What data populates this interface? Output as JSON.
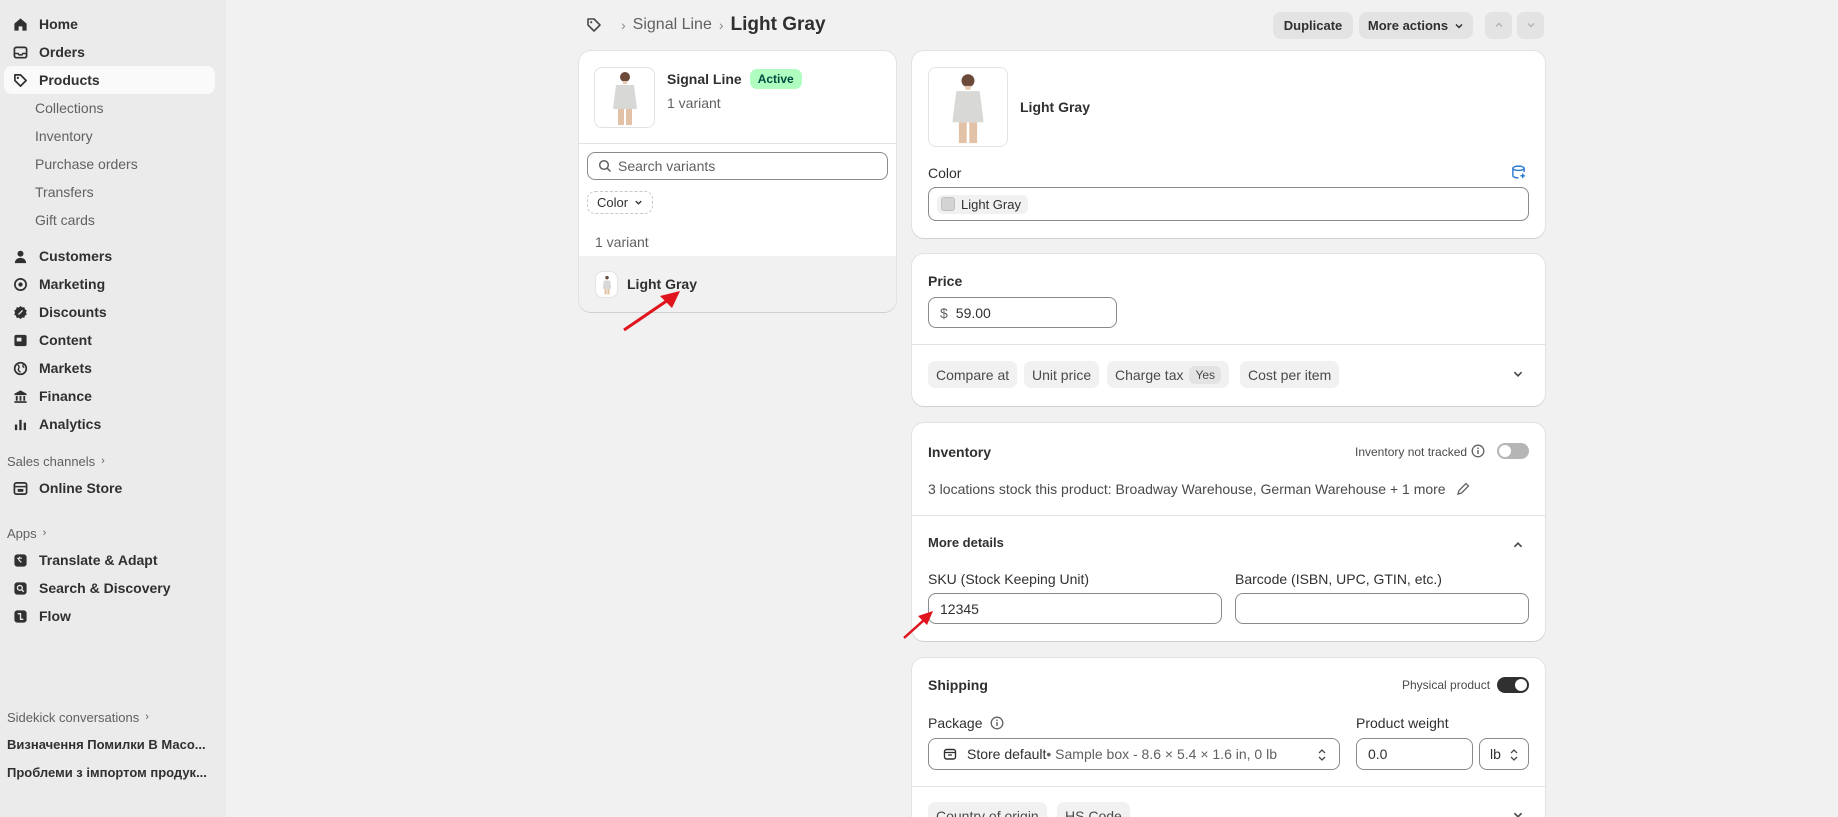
{
  "sidebar": {
    "nav": [
      {
        "label": "Home",
        "icon": "home-icon"
      },
      {
        "label": "Orders",
        "icon": "inbox-icon"
      },
      {
        "label": "Products",
        "icon": "tag-icon"
      }
    ],
    "product_sub": [
      "Collections",
      "Inventory",
      "Purchase orders",
      "Transfers",
      "Gift cards"
    ],
    "nav2": [
      {
        "label": "Customers",
        "icon": "person-icon"
      },
      {
        "label": "Marketing",
        "icon": "target-icon"
      },
      {
        "label": "Discounts",
        "icon": "discount-icon"
      },
      {
        "label": "Content",
        "icon": "content-icon"
      },
      {
        "label": "Markets",
        "icon": "globe-icon"
      },
      {
        "label": "Finance",
        "icon": "bank-icon"
      },
      {
        "label": "Analytics",
        "icon": "chart-icon"
      }
    ],
    "sales_channels_label": "Sales channels",
    "online_store": "Online Store",
    "apps_label": "Apps",
    "apps": [
      "Translate & Adapt",
      "Search & Discovery",
      "Flow"
    ],
    "sidekick_label": "Sidekick conversations",
    "conversations": [
      "Визначення Помилки В Масо...",
      "Проблеми з імпортом продук..."
    ]
  },
  "header": {
    "crumb": "Signal Line",
    "title": "Light Gray",
    "duplicate": "Duplicate",
    "more_actions": "More actions"
  },
  "variants_card": {
    "product_name": "Signal Line",
    "status": "Active",
    "variant_count": "1 variant",
    "search_placeholder": "Search variants",
    "filter_label": "Color",
    "list_count": "1 variant",
    "variant_name": "Light Gray"
  },
  "variant_card": {
    "name": "Light Gray",
    "color_label": "Color",
    "color_value": "Light Gray"
  },
  "price_card": {
    "label": "Price",
    "currency": "$",
    "value": "59.00",
    "compare_at": "Compare at",
    "unit_price": "Unit price",
    "charge_tax": "Charge tax",
    "charge_tax_value": "Yes",
    "cost_per_item": "Cost per item"
  },
  "inventory_card": {
    "title": "Inventory",
    "tracked_label": "Inventory not tracked",
    "locations_text": "3 locations stock this product: Broadway Warehouse, German Warehouse + 1 more",
    "more_details": "More details",
    "sku_label": "SKU (Stock Keeping Unit)",
    "sku_value": "12345",
    "barcode_label": "Barcode (ISBN, UPC, GTIN, etc.)",
    "barcode_value": ""
  },
  "shipping_card": {
    "title": "Shipping",
    "physical_label": "Physical product",
    "package_label": "Package",
    "package_value": "Store default",
    "package_detail": " • Sample box - 8.6 × 5.4 × 1.6 in, 0 lb",
    "weight_label": "Product weight",
    "weight_value": "0.0",
    "weight_unit": "lb",
    "country_of_origin": "Country of origin",
    "hs_code": "HS Code"
  },
  "colors": {
    "active_badge_bg": "#affebf",
    "toggle_on": "#303030",
    "toggle_off": "#b5b5b5",
    "annotation_arrow": "#e0141c"
  }
}
